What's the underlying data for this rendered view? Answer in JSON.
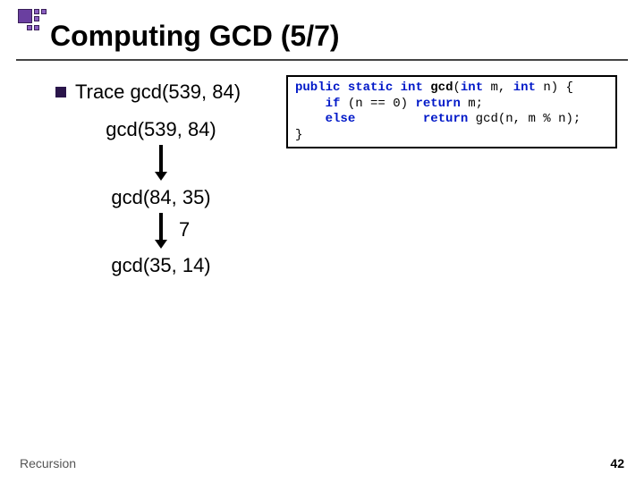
{
  "slide": {
    "title": "Computing GCD (5/7)",
    "bullet": "Trace gcd(539, 84)",
    "trace": {
      "calls": [
        "gcd(539, 84)",
        "gcd(84, 35)",
        "gcd(35, 14)"
      ],
      "result_mid": "7"
    },
    "code": {
      "kw_public": "public",
      "kw_static": "static",
      "kw_int0": "int",
      "fn_name": "gcd",
      "sig_open": "(",
      "kw_int1": "int",
      "param_m": " m, ",
      "kw_int2": "int",
      "param_n": " n) {",
      "line2a": "    ",
      "kw_if": "if",
      "line2b": " (n == 0) ",
      "kw_return1": "return",
      "line2c": " m;",
      "line3a": "    ",
      "kw_else": "else",
      "line3b": "         ",
      "kw_return2": "return",
      "line3c": " gcd(n, m % n);",
      "line4": "}"
    },
    "footer": {
      "left": "Recursion",
      "page": "42"
    }
  }
}
